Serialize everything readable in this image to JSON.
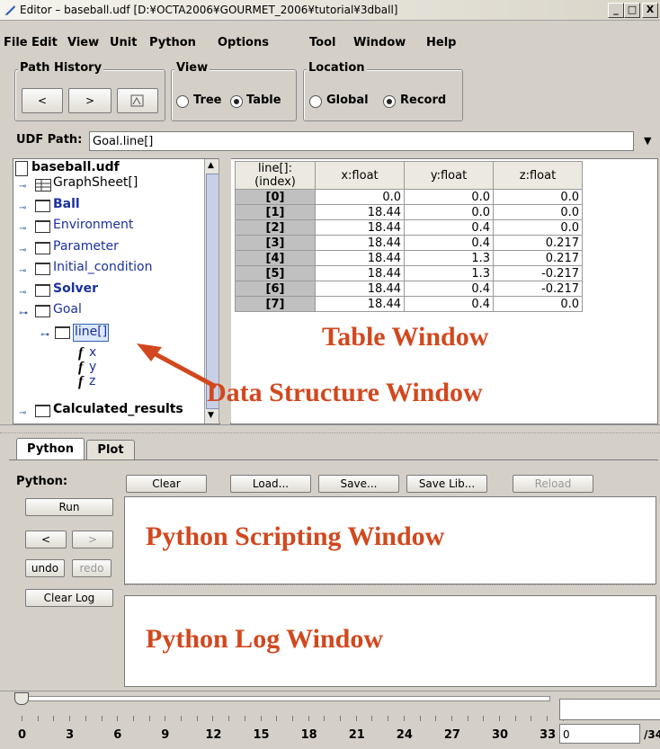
{
  "window": {
    "title": "Editor – baseball.udf [D:¥OCTA2006¥GOURMET_2006¥tutorial¥3dball]",
    "min": "_",
    "max": "□",
    "close": "X"
  },
  "menu": [
    "File",
    "Edit",
    "View",
    "Unit",
    "Python",
    "Options",
    "Tool",
    "Window",
    "Help"
  ],
  "path_history": {
    "title": "Path History",
    "back": "<",
    "forward": ">"
  },
  "view": {
    "title": "View",
    "options": [
      "Tree",
      "Table"
    ],
    "selected": "Table"
  },
  "location": {
    "title": "Location",
    "options": [
      "Global",
      "Record"
    ],
    "selected": "Record"
  },
  "udf_path": {
    "label": "UDF Path:",
    "value": "Goal.line[]"
  },
  "tree": {
    "root": "baseball.udf",
    "items": [
      {
        "label": "GraphSheet[]",
        "bold": true,
        "blue": false
      },
      {
        "label": "Ball",
        "bold": true,
        "blue": true
      },
      {
        "label": "Environment",
        "bold": false,
        "blue": true
      },
      {
        "label": "Parameter",
        "bold": false,
        "blue": true
      },
      {
        "label": "Initial_condition",
        "bold": false,
        "blue": true
      },
      {
        "label": "Solver",
        "bold": true,
        "blue": true
      },
      {
        "label": "Goal",
        "bold": false,
        "blue": true
      },
      {
        "label": "line[]",
        "bold": false,
        "blue": true
      },
      {
        "label": "x",
        "bold": false,
        "blue": true
      },
      {
        "label": "y",
        "bold": false,
        "blue": true
      },
      {
        "label": "z",
        "bold": false,
        "blue": true
      },
      {
        "label": "Calculated_results",
        "bold": true,
        "blue": false
      }
    ]
  },
  "table": {
    "headers": [
      "line[]:(index)",
      "x:float",
      "y:float",
      "z:float"
    ],
    "rows": [
      [
        "[0]",
        "0.0",
        "0.0",
        "0.0"
      ],
      [
        "[1]",
        "18.44",
        "0.0",
        "0.0"
      ],
      [
        "[2]",
        "18.44",
        "0.4",
        "0.0"
      ],
      [
        "[3]",
        "18.44",
        "0.4",
        "0.217"
      ],
      [
        "[4]",
        "18.44",
        "1.3",
        "0.217"
      ],
      [
        "[5]",
        "18.44",
        "1.3",
        "-0.217"
      ],
      [
        "[6]",
        "18.44",
        "0.4",
        "-0.217"
      ],
      [
        "[7]",
        "18.44",
        "0.4",
        "0.0"
      ]
    ]
  },
  "annotations": {
    "table_window": "Table Window",
    "data_structure_window": "Data Structure Window",
    "python_scripting_window": "Python Scripting Window",
    "python_log_window": "Python Log Window",
    "arrow_color": "#d2481e"
  },
  "tabs": [
    "Python",
    "Plot"
  ],
  "python": {
    "label": "Python:",
    "toolbar": [
      "Clear",
      "Load...",
      "Save...",
      "Save Lib...",
      "Reload"
    ],
    "run": "Run",
    "prev": "<",
    "next": ">",
    "undo": "undo",
    "redo": "redo",
    "clear_log": "Clear Log"
  },
  "slider": {
    "ticks": [
      "0",
      "3",
      "6",
      "9",
      "12",
      "15",
      "18",
      "21",
      "24",
      "27",
      "30",
      "33"
    ],
    "value": "0",
    "total": "/34"
  }
}
